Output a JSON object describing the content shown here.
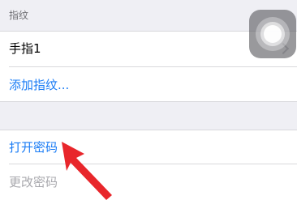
{
  "fingerprints_section": {
    "header": "指纹",
    "items": [
      {
        "label": "手指1"
      }
    ],
    "add_label": "添加指纹..."
  },
  "passcode_section": {
    "turn_on_label": "打开密码",
    "change_label": "更改密码"
  },
  "icons": {
    "assistive_touch": "assistive-touch-icon",
    "chevron": "chevron-right-icon",
    "annotation_arrow": "red-arrow-icon"
  },
  "colors": {
    "background": "#efeff4",
    "link_blue": "#1a7cf5",
    "disabled_grey": "#a8a8ad",
    "annotation_red": "#e8262b"
  }
}
